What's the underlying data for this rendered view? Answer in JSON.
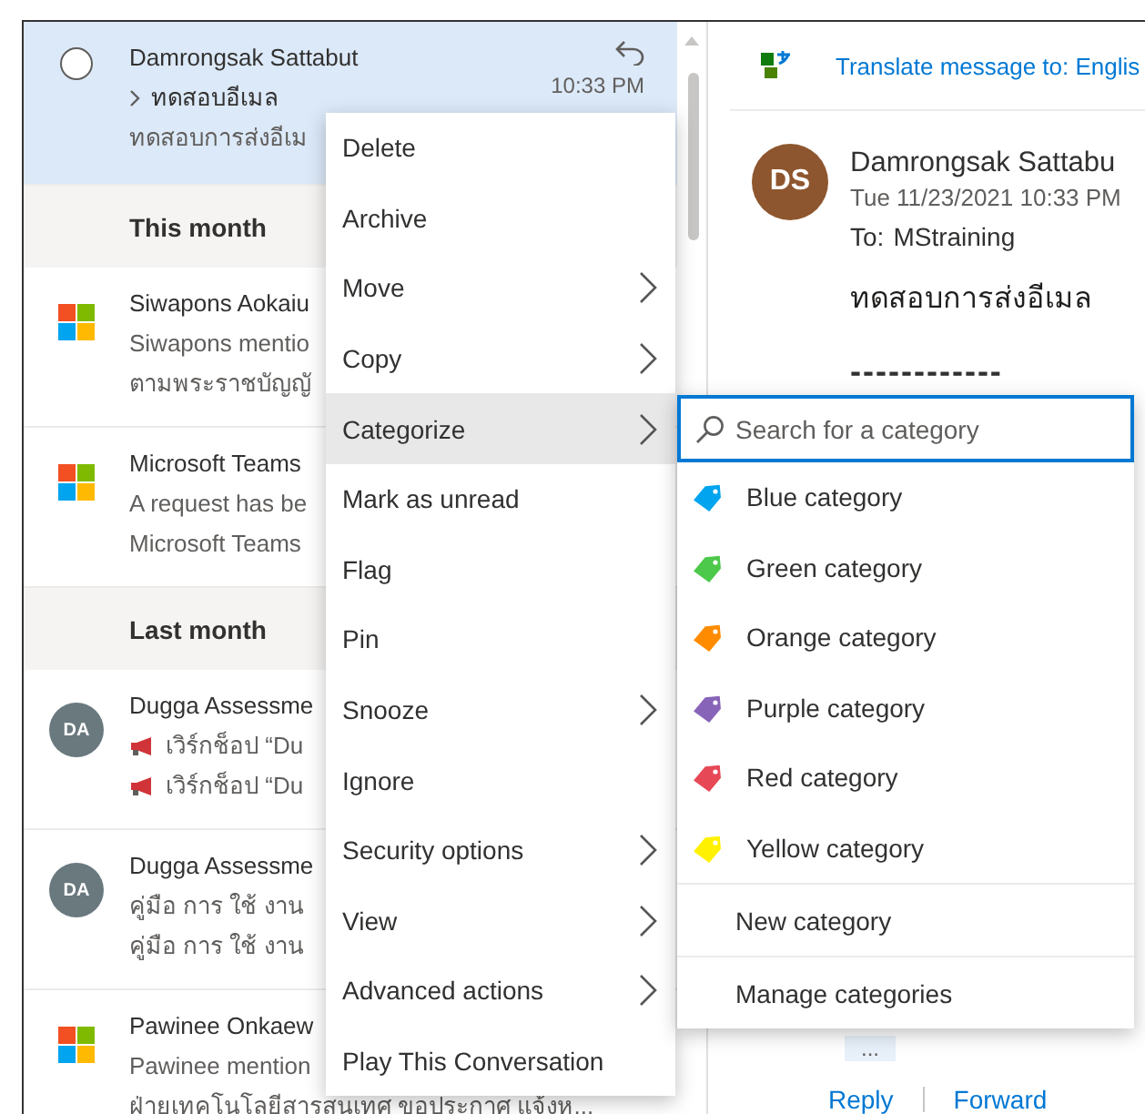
{
  "message_list": [
    {
      "kind": "message",
      "avatar": {
        "kind": "radio"
      },
      "selected": true,
      "sender": "Damrongsak Sattabut",
      "subject": "ทดสอบอีเมล",
      "time": "10:33 PM",
      "lines": [
        "ทดสอบการส่งอีเม"
      ],
      "replied": true
    },
    {
      "kind": "header",
      "label": "This month"
    },
    {
      "kind": "message",
      "avatar": {
        "kind": "logo"
      },
      "selected": false,
      "sender": "Siwapons Aokaiu",
      "lines": [
        "Siwapons mentio",
        "ตามพระราชบัญญั"
      ],
      "replied": false
    },
    {
      "kind": "message",
      "avatar": {
        "kind": "logo"
      },
      "selected": false,
      "sender": "Microsoft Teams",
      "lines": [
        "A request has be",
        "Microsoft Teams"
      ],
      "replied": false
    },
    {
      "kind": "header",
      "label": "Last month"
    },
    {
      "kind": "message",
      "avatar": {
        "kind": "initials",
        "initials": "DA"
      },
      "selected": false,
      "sender": "Dugga Assessme",
      "lines": [
        "เวิร์กช็อป “Du",
        "เวิร์กช็อป “Du"
      ],
      "megaphone": true,
      "replied": false
    },
    {
      "kind": "message",
      "avatar": {
        "kind": "initials",
        "initials": "DA"
      },
      "selected": false,
      "sender": "Dugga Assessme",
      "lines": [
        "คู่มือ การ ใช้ งาน",
        "คู่มือ การ ใช้ งาน"
      ],
      "replied": false
    },
    {
      "kind": "message",
      "avatar": {
        "kind": "logo"
      },
      "selected": false,
      "sender": "Pawinee Onkaew",
      "lines": [
        "Pawinee mention",
        "ฝ่ายเทคโนโลยีสารสนเทศ ขอประกาศ แจ้งห..."
      ],
      "replied": false
    }
  ],
  "reading_pane": {
    "translate": "Translate message to: Englis",
    "avatar_initials": "DS",
    "sender": "Damrongsak Sattabu",
    "date": "Tue 11/23/2021 10:33 PM",
    "to_label": "To:",
    "to": "MStraining",
    "body": "ทดสอบการส่งอีเมล",
    "divider_text": "------------",
    "more": "...",
    "actions": [
      "Reply",
      "Forward"
    ]
  },
  "context_menu": [
    {
      "label": "Delete",
      "submenu": false,
      "selected": false
    },
    {
      "label": "Archive",
      "submenu": false,
      "selected": false
    },
    {
      "label": "Move",
      "submenu": true,
      "selected": false
    },
    {
      "label": "Copy",
      "submenu": true,
      "selected": false
    },
    {
      "label": "Categorize",
      "submenu": true,
      "selected": true
    },
    {
      "label": "Mark as unread",
      "submenu": false,
      "selected": false
    },
    {
      "label": "Flag",
      "submenu": false,
      "selected": false
    },
    {
      "label": "Pin",
      "submenu": false,
      "selected": false
    },
    {
      "label": "Snooze",
      "submenu": true,
      "selected": false
    },
    {
      "label": "Ignore",
      "submenu": false,
      "selected": false
    },
    {
      "label": "Security options",
      "submenu": true,
      "selected": false
    },
    {
      "label": "View",
      "submenu": true,
      "selected": false
    },
    {
      "label": "Advanced actions",
      "submenu": true,
      "selected": false
    },
    {
      "label": "Play This Conversation",
      "submenu": false,
      "selected": false
    }
  ],
  "category_menu": {
    "search": {
      "placeholder": "Search for a category"
    },
    "categories": [
      {
        "name": "Blue category",
        "color": "#00a4ef"
      },
      {
        "name": "Green category",
        "color": "#4cc84a"
      },
      {
        "name": "Orange category",
        "color": "#ff8c00"
      },
      {
        "name": "Purple category",
        "color": "#8764b8"
      },
      {
        "name": "Red category",
        "color": "#e74856"
      },
      {
        "name": "Yellow category",
        "color": "#fff100"
      }
    ],
    "actions": [
      "New category",
      "Manage categories"
    ]
  }
}
